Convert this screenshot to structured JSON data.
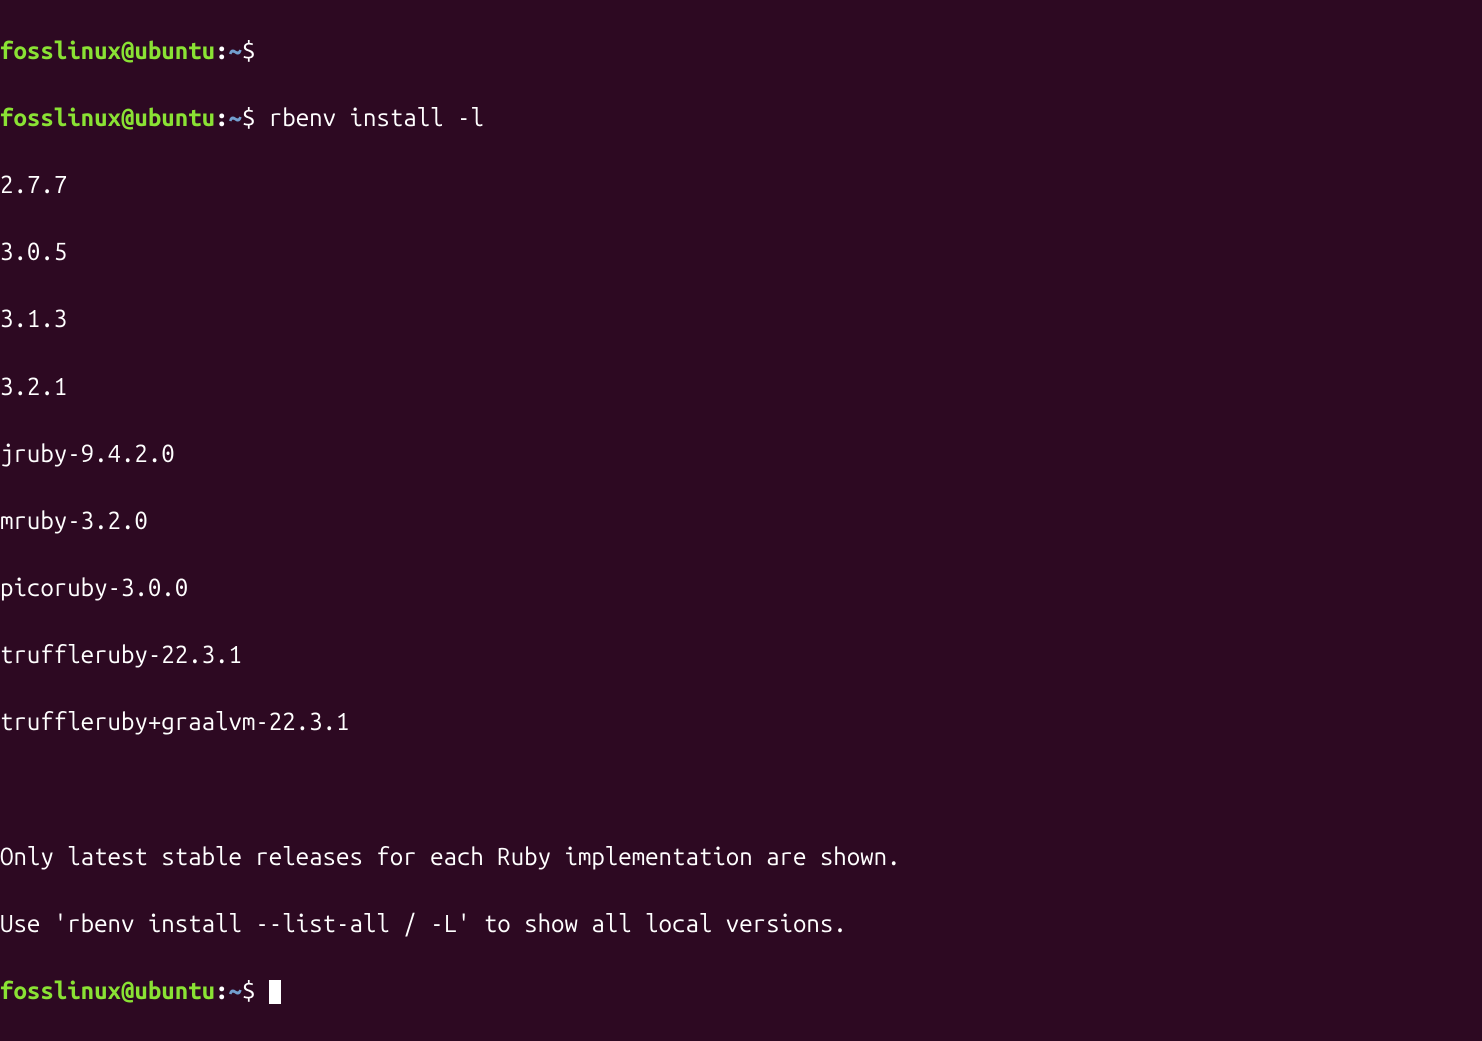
{
  "prompt": {
    "user_host": "fosslinux@ubuntu",
    "colon": ":",
    "path": "~",
    "symbol": "$"
  },
  "commands": {
    "empty": "",
    "main": "rbenv install -l"
  },
  "output": {
    "versions": [
      "2.7.7",
      "3.0.5",
      "3.1.3",
      "3.2.1",
      "jruby-9.4.2.0",
      "mruby-3.2.0",
      "picoruby-3.0.0",
      "truffleruby-22.3.1",
      "truffleruby+graalvm-22.3.1"
    ],
    "note1": "Only latest stable releases for each Ruby implementation are shown.",
    "note2": "Use 'rbenv install --list-all / -L' to show all local versions."
  }
}
